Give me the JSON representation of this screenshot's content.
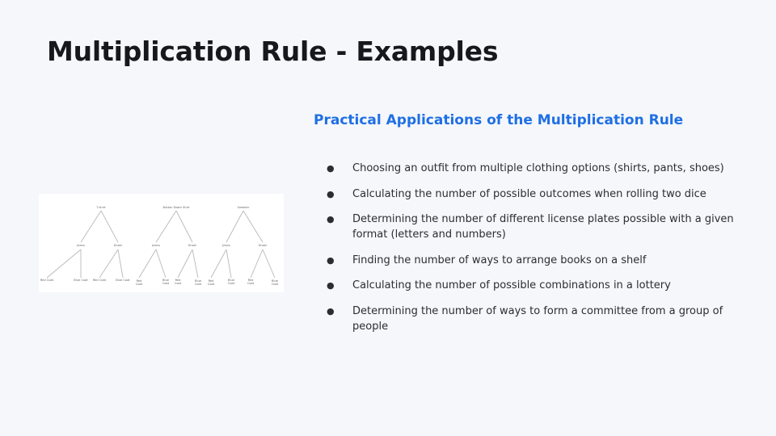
{
  "slide": {
    "title": "Multiplication Rule - Examples",
    "subtitle": "Practical Applications of the Multiplication Rule"
  },
  "bullets": [
    "Choosing an outfit from multiple clothing options (shirts, pants, shoes)",
    "Calculating the number of possible outcomes when rolling two dice",
    "Determining the number of different license plates possible with a given format (letters and numbers)",
    "Finding the number of ways to arrange books on a shelf",
    "Calculating the number of possible combinations in a lottery",
    "Determining the number of ways to form a committee from a group of people"
  ],
  "bullet_marker": "●",
  "tree_diagram": {
    "roots": [
      {
        "label": "T-shirt",
        "children": [
          {
            "label": "Jeans",
            "leaves": [
              [
                "Red",
                "Coat"
              ],
              [
                "Blue",
                "Coat"
              ]
            ]
          },
          {
            "label": "Khaki",
            "leaves": [
              [
                "Red",
                "Coat"
              ],
              [
                "Blue",
                "Coat"
              ]
            ]
          }
        ]
      },
      {
        "label": "Button Down Shirt",
        "children": [
          {
            "label": "Jeans",
            "leaves": [
              [
                "Red",
                "Coat"
              ],
              [
                "Blue",
                "Coat"
              ]
            ]
          },
          {
            "label": "Khaki",
            "leaves": [
              [
                "Red",
                "Coat"
              ],
              [
                "Blue",
                "Coat"
              ]
            ]
          }
        ]
      },
      {
        "label": "Sweater",
        "children": [
          {
            "label": "Jeans",
            "leaves": [
              [
                "Red",
                "Coat"
              ],
              [
                "Blue",
                "Coat"
              ]
            ]
          },
          {
            "label": "Khaki",
            "leaves": [
              [
                "Red",
                "Coat"
              ],
              [
                "Blue",
                "Coat"
              ]
            ]
          }
        ]
      }
    ],
    "line_color": "#b8b8b8"
  }
}
